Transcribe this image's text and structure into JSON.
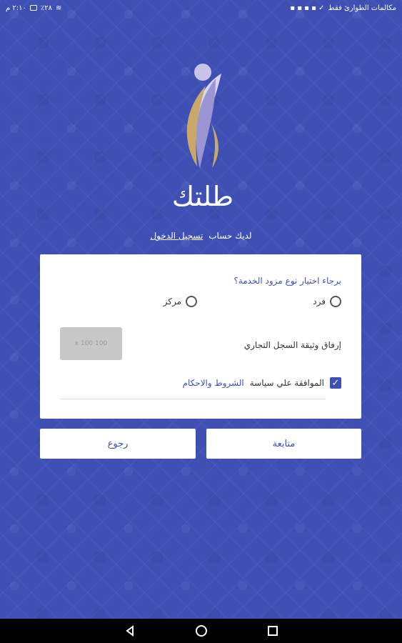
{
  "status_bar": {
    "time": "٢:١٠ م",
    "battery": "٪٢٨",
    "notification_text": "مكالمات الطوارئ فقط"
  },
  "brand": {
    "name": "طلتك"
  },
  "login_prompt": {
    "text": "لديك حساب",
    "link": "تسجيل الدخول"
  },
  "form": {
    "question": "برجاء اختيار نوع مزود الخدمة؟",
    "options": [
      "فرد",
      "مركز"
    ],
    "attach_label": "إرفاق وثيقة السجل التجاري",
    "image_placeholder": "100 x 100",
    "terms_prefix": "الموافقة علي سياسة",
    "terms_link": "الشروط والاحكام",
    "terms_checked": true
  },
  "buttons": {
    "next": "متابعة",
    "back": "رجوع"
  },
  "colors": {
    "primary": "#3f50b5",
    "card": "#ffffff"
  }
}
